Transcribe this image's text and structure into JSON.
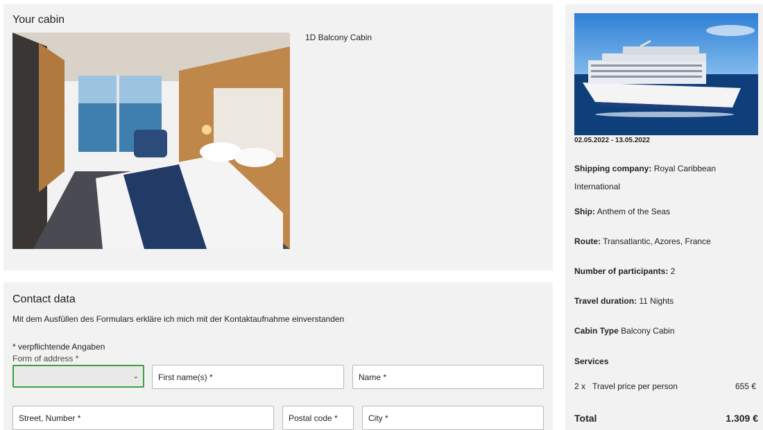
{
  "cabin": {
    "title": "Your cabin",
    "name": "1D Balcony Cabin"
  },
  "contact": {
    "title": "Contact data",
    "consent": "Mit dem Ausfüllen des Formulars erkläre ich mich mit der Kontaktaufnahme einverstanden",
    "required_note": "* verpflichtende Angaben",
    "address_label": "Form of address *",
    "address_value": "",
    "first_name_placeholder": "First name(s) *",
    "name_placeholder": "Name *",
    "street_placeholder": "Street, Number *",
    "postal_placeholder": "Postal code *",
    "city_placeholder": "City *"
  },
  "summary": {
    "dates": "02.05.2022 - 13.05.2022",
    "shipping_company_label": "Shipping company:",
    "shipping_company": "Royal Caribbean International",
    "ship_label": "Ship:",
    "ship": "Anthem of the Seas",
    "route_label": "Route:",
    "route": "Transatlantic, Azores, France",
    "participants_label": "Number of participants:",
    "participants": "2",
    "duration_label": "Travel duration:",
    "duration": "11 Nights",
    "cabin_type_label": "Cabin Type",
    "cabin_type": "Balcony Cabin",
    "services_title": "Services",
    "service_qty": "2 x",
    "service_desc": "Travel price per person",
    "service_price": "655 €",
    "total_label": "Total",
    "total_value": "1.309 €"
  },
  "colors": {
    "panel_bg": "#f2f2f2",
    "select_border": "#3f9f3f"
  },
  "icons": {
    "select_chevron": "chevron-down-icon"
  }
}
